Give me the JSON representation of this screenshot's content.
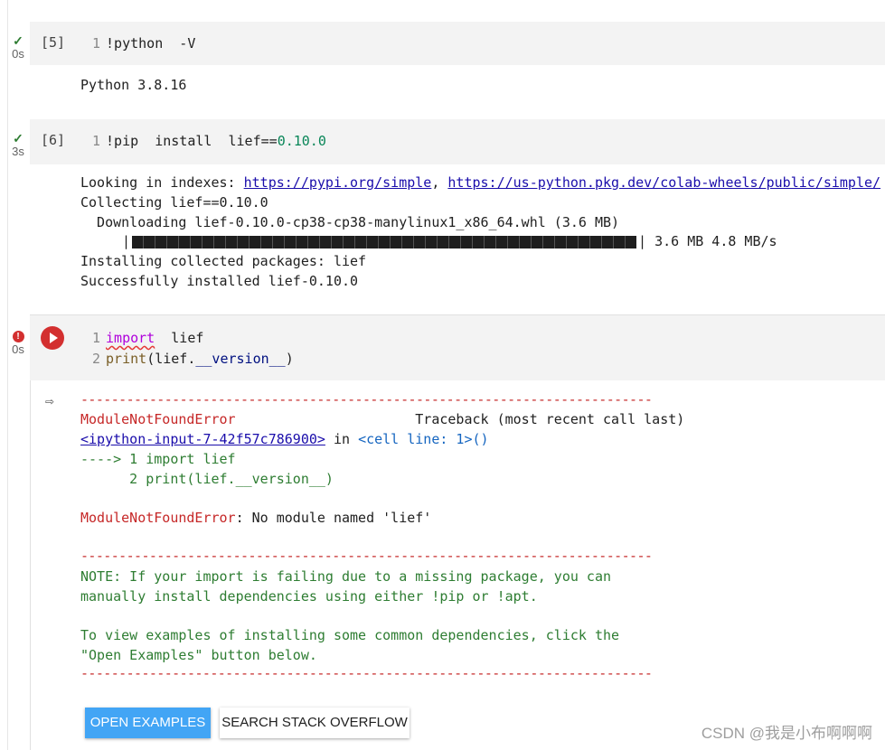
{
  "cells": [
    {
      "status": "✓",
      "time": "0s",
      "exec_count": "[5]",
      "code": [
        {
          "ln": "1",
          "text": "!python  -V"
        }
      ],
      "output": [
        "Python 3.8.16"
      ]
    },
    {
      "status": "✓",
      "time": "3s",
      "exec_count": "[6]",
      "code": [
        {
          "ln": "1",
          "prefix": "!pip  install  lief==",
          "num": "0.10.0"
        }
      ],
      "output": {
        "looking_prefix": "Looking in indexes: ",
        "link1": "https://pypi.org/simple",
        "sep": ", ",
        "link2": "https://us-python.pkg.dev/colab-wheels/public/simple/",
        "collecting": "Collecting lief==0.10.0",
        "downloading": "  Downloading lief-0.10.0-cp38-cp38-manylinux1_x86_64.whl (3.6 MB)",
        "progress_fraction": 1.0,
        "progress_text": "3.6 MB 4.8 MB/s",
        "installing": "Installing collected packages: lief",
        "success": "Successfully installed lief-0.10.0"
      }
    },
    {
      "status": "!",
      "time": "0s",
      "code": [
        {
          "ln": "1",
          "kw": "import",
          "rest": "  lief"
        },
        {
          "ln": "2",
          "fn": "print",
          "p1": "(lief.",
          "attr": "__version__",
          "p2": ")"
        }
      ],
      "error": {
        "dashes": "---------------------------------------------------------------------------",
        "name": "ModuleNotFoundError",
        "traceback_label": "Traceback (most recent call last)",
        "input_link": "<ipython-input-7-42f57c786900>",
        "in_text": " in ",
        "cell_line": "<cell line: 1>",
        "parens": "()",
        "arrow_line": "----> 1 import lief",
        "line2": "      2 print(lief.__version__)",
        "msg_name": "ModuleNotFoundError",
        "msg": ": No module named 'lief'",
        "note1": "NOTE: If your import is failing due to a missing package, you can",
        "note2": "manually install dependencies using either !pip or !apt.",
        "note3": "To view examples of installing some common dependencies, click the",
        "note4": "\"Open Examples\" button below."
      },
      "buttons": {
        "open_examples": "OPEN EXAMPLES",
        "search_so": "SEARCH STACK OVERFLOW"
      }
    }
  ],
  "watermark": "CSDN @我是小布啊啊啊",
  "colors": {
    "error_red": "#d32f2f",
    "primary_button": "#42a5f5",
    "cell_bg": "#f3f3f3"
  }
}
